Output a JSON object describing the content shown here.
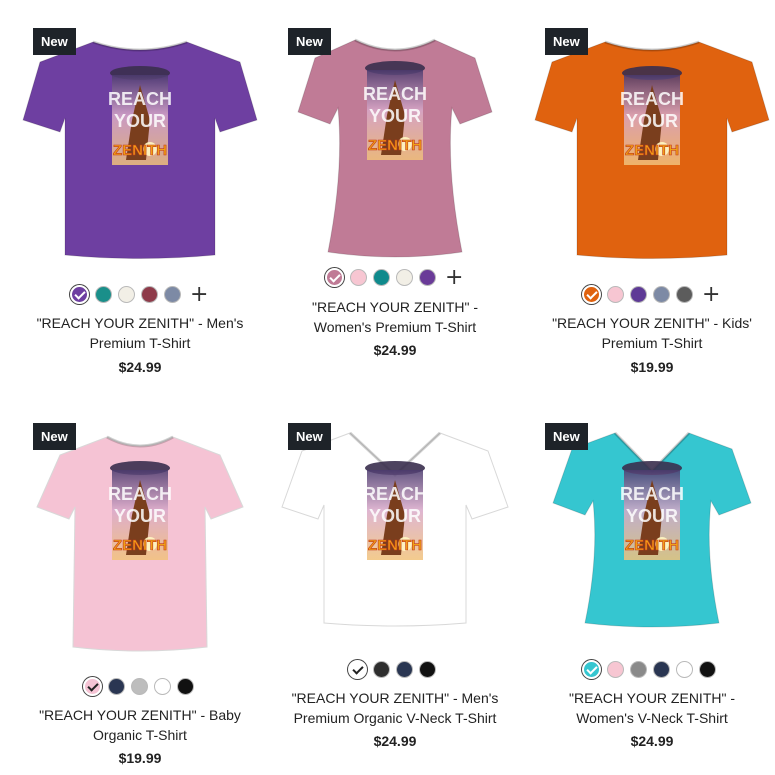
{
  "products": [
    {
      "badge": "New",
      "shirt_color": "#6e3fa1",
      "swatches": [
        "#6e3fa1",
        "#1a8f8a",
        "#f2efe6",
        "#8e3b4a",
        "#7d8aa5"
      ],
      "selected_swatch": 0,
      "more_colors": "+",
      "name_line1": "\"REACH YOUR ZENITH\" - Men's",
      "name_line2": "Premium T-Shirt",
      "price": "$24.99"
    },
    {
      "badge": "New",
      "shirt_color": "#c07b96",
      "swatches": [
        "#c07b96",
        "#f7c6d2",
        "#0f8a8c",
        "#f2efe6",
        "#6a3b98"
      ],
      "selected_swatch": 0,
      "more_colors": "+",
      "name_line1": "\"REACH YOUR ZENITH\" -",
      "name_line2": "Women's Premium T-Shirt",
      "price": "$24.99"
    },
    {
      "badge": "New",
      "shirt_color": "#e0620f",
      "swatches": [
        "#e0620f",
        "#f7c6d2",
        "#5e3a96",
        "#7d8aa5",
        "#5c5c5c"
      ],
      "selected_swatch": 0,
      "more_colors": "+",
      "name_line1": "\"REACH YOUR ZENITH\" - Kids'",
      "name_line2": "Premium T-Shirt",
      "price": "$19.99"
    },
    {
      "badge": "New",
      "shirt_color": "#f5c3d4",
      "swatches": [
        "#f5c3d4",
        "#2a3652",
        "#bdbdbd",
        "#ffffff",
        "#111111"
      ],
      "selected_swatch": 0,
      "more_colors": "",
      "name_line1": "\"REACH YOUR ZENITH\" - Baby",
      "name_line2": "Organic T-Shirt",
      "price": "$19.99"
    },
    {
      "badge": "New",
      "shirt_color": "#ffffff",
      "swatches": [
        "#ffffff",
        "#2e2e2e",
        "#2a3652",
        "#111111"
      ],
      "selected_swatch": 0,
      "more_colors": "",
      "name_line1": "\"REACH YOUR ZENITH\" - Men's",
      "name_line2": "Premium Organic V-Neck T-Shirt",
      "price": "$24.99"
    },
    {
      "badge": "New",
      "shirt_color": "#35c6d0",
      "swatches": [
        "#35c6d0",
        "#f7c6d2",
        "#8a8a8a",
        "#2a3652",
        "#ffffff",
        "#111111"
      ],
      "selected_swatch": 0,
      "more_colors": "",
      "name_line1": "\"REACH YOUR ZENITH\" -",
      "name_line2": "Women's V-Neck T-Shirt",
      "price": "$24.99"
    }
  ],
  "print_text": {
    "line1": "REACH",
    "line2": "YOUR",
    "line3": "ZENITH"
  }
}
